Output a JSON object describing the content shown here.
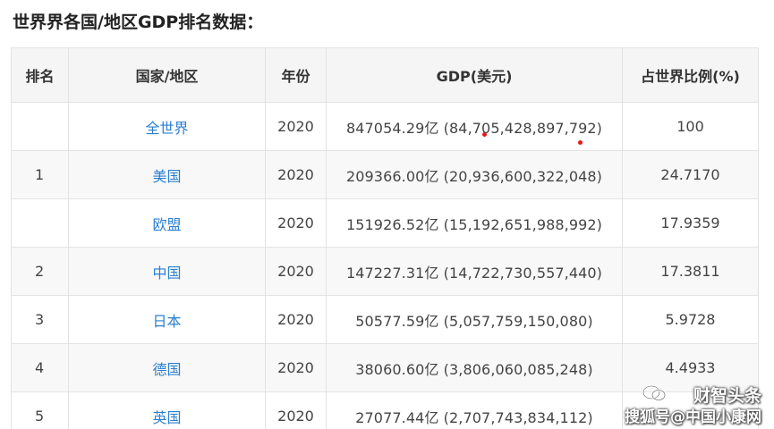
{
  "title": "世界界各国/地区GDP排名数据：",
  "table": {
    "headers": [
      "排名",
      "国家/地区",
      "年份",
      "GDP(美元)",
      "占世界比例(%)"
    ],
    "rows": [
      {
        "rank": "",
        "country": "全世界",
        "year": "2020",
        "gdp": "847054.29亿 (84,705,428,897,792)",
        "share": "100"
      },
      {
        "rank": "1",
        "country": "美国",
        "year": "2020",
        "gdp": "209366.00亿 (20,936,600,322,048)",
        "share": "24.7170"
      },
      {
        "rank": "",
        "country": "欧盟",
        "year": "2020",
        "gdp": "151926.52亿 (15,192,651,988,992)",
        "share": "17.9359"
      },
      {
        "rank": "2",
        "country": "中国",
        "year": "2020",
        "gdp": "147227.31亿 (14,722,730,557,440)",
        "share": "17.3811"
      },
      {
        "rank": "3",
        "country": "日本",
        "year": "2020",
        "gdp": "50577.59亿 (5,057,759,150,080)",
        "share": "5.9728"
      },
      {
        "rank": "4",
        "country": "德国",
        "year": "2020",
        "gdp": "38060.60亿 (3,806,060,085,248)",
        "share": "4.4933"
      },
      {
        "rank": "5",
        "country": "英国",
        "year": "2020",
        "gdp": "27077.44亿 (2,707,743,834,112)",
        "share": ""
      }
    ]
  },
  "watermark": {
    "line1": "财智头条",
    "line2": "搜狐号@中国小康网"
  },
  "colors": {
    "link": "#2b7fd0",
    "header_bg": "#f5f5f5",
    "border": "#e3e3e3",
    "red_mark": "#e81818"
  }
}
